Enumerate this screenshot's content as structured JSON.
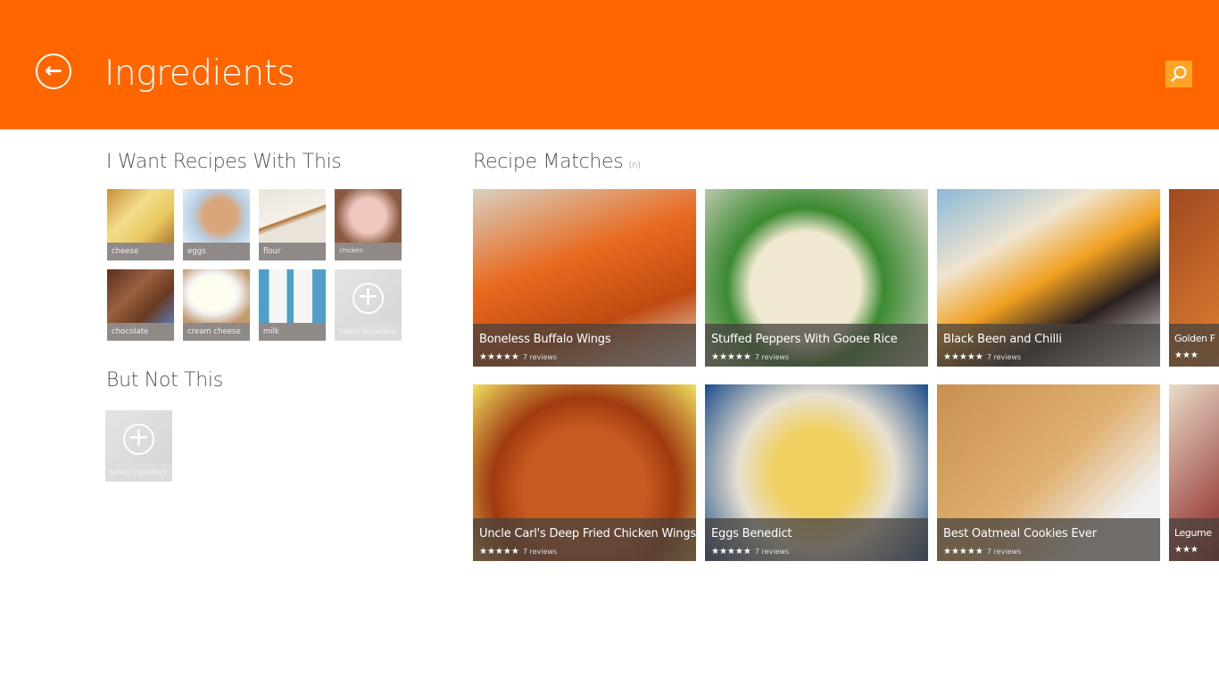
{
  "header": {
    "title": "Ingredients",
    "back_icon": "back-arrow-icon",
    "search_icon": "search-icon",
    "color": "#FF6600"
  },
  "want": {
    "heading": "I Want Recipes With This",
    "items": [
      {
        "label": "cheese"
      },
      {
        "label": "eggs"
      },
      {
        "label": "flour"
      },
      {
        "label": "chicken"
      },
      {
        "label": "chocolate"
      },
      {
        "label": "cream cheese"
      },
      {
        "label": "milk"
      }
    ],
    "add_label": "Select Ingredient"
  },
  "exclude": {
    "heading": "But Not This",
    "add_label": "Select Ingredient"
  },
  "matches": {
    "heading": "Recipe Matches",
    "count": "(n)",
    "recipes": [
      {
        "name": "Boneless Buffalo Wings",
        "stars": "★★★★★",
        "reviews": "7 reviews"
      },
      {
        "name": "Stuffed Peppers With Gooee Rice",
        "stars": "★★★★★",
        "reviews": "7 reviews"
      },
      {
        "name": "Black Been and Chilli",
        "stars": "★★★★★",
        "reviews": "7 reviews"
      },
      {
        "name": "Golden F",
        "stars": "★★★",
        "reviews": ""
      },
      {
        "name": "Uncle Carl's Deep Fried Chicken Wings",
        "stars": "★★★★★",
        "reviews": "7 reviews"
      },
      {
        "name": "Eggs Benedict",
        "stars": "★★★★★",
        "reviews": "7 reviews"
      },
      {
        "name": "Best Oatmeal Cookies Ever",
        "stars": "★★★★★",
        "reviews": "7 reviews"
      },
      {
        "name": "Legume",
        "stars": "★★★",
        "reviews": ""
      }
    ]
  }
}
